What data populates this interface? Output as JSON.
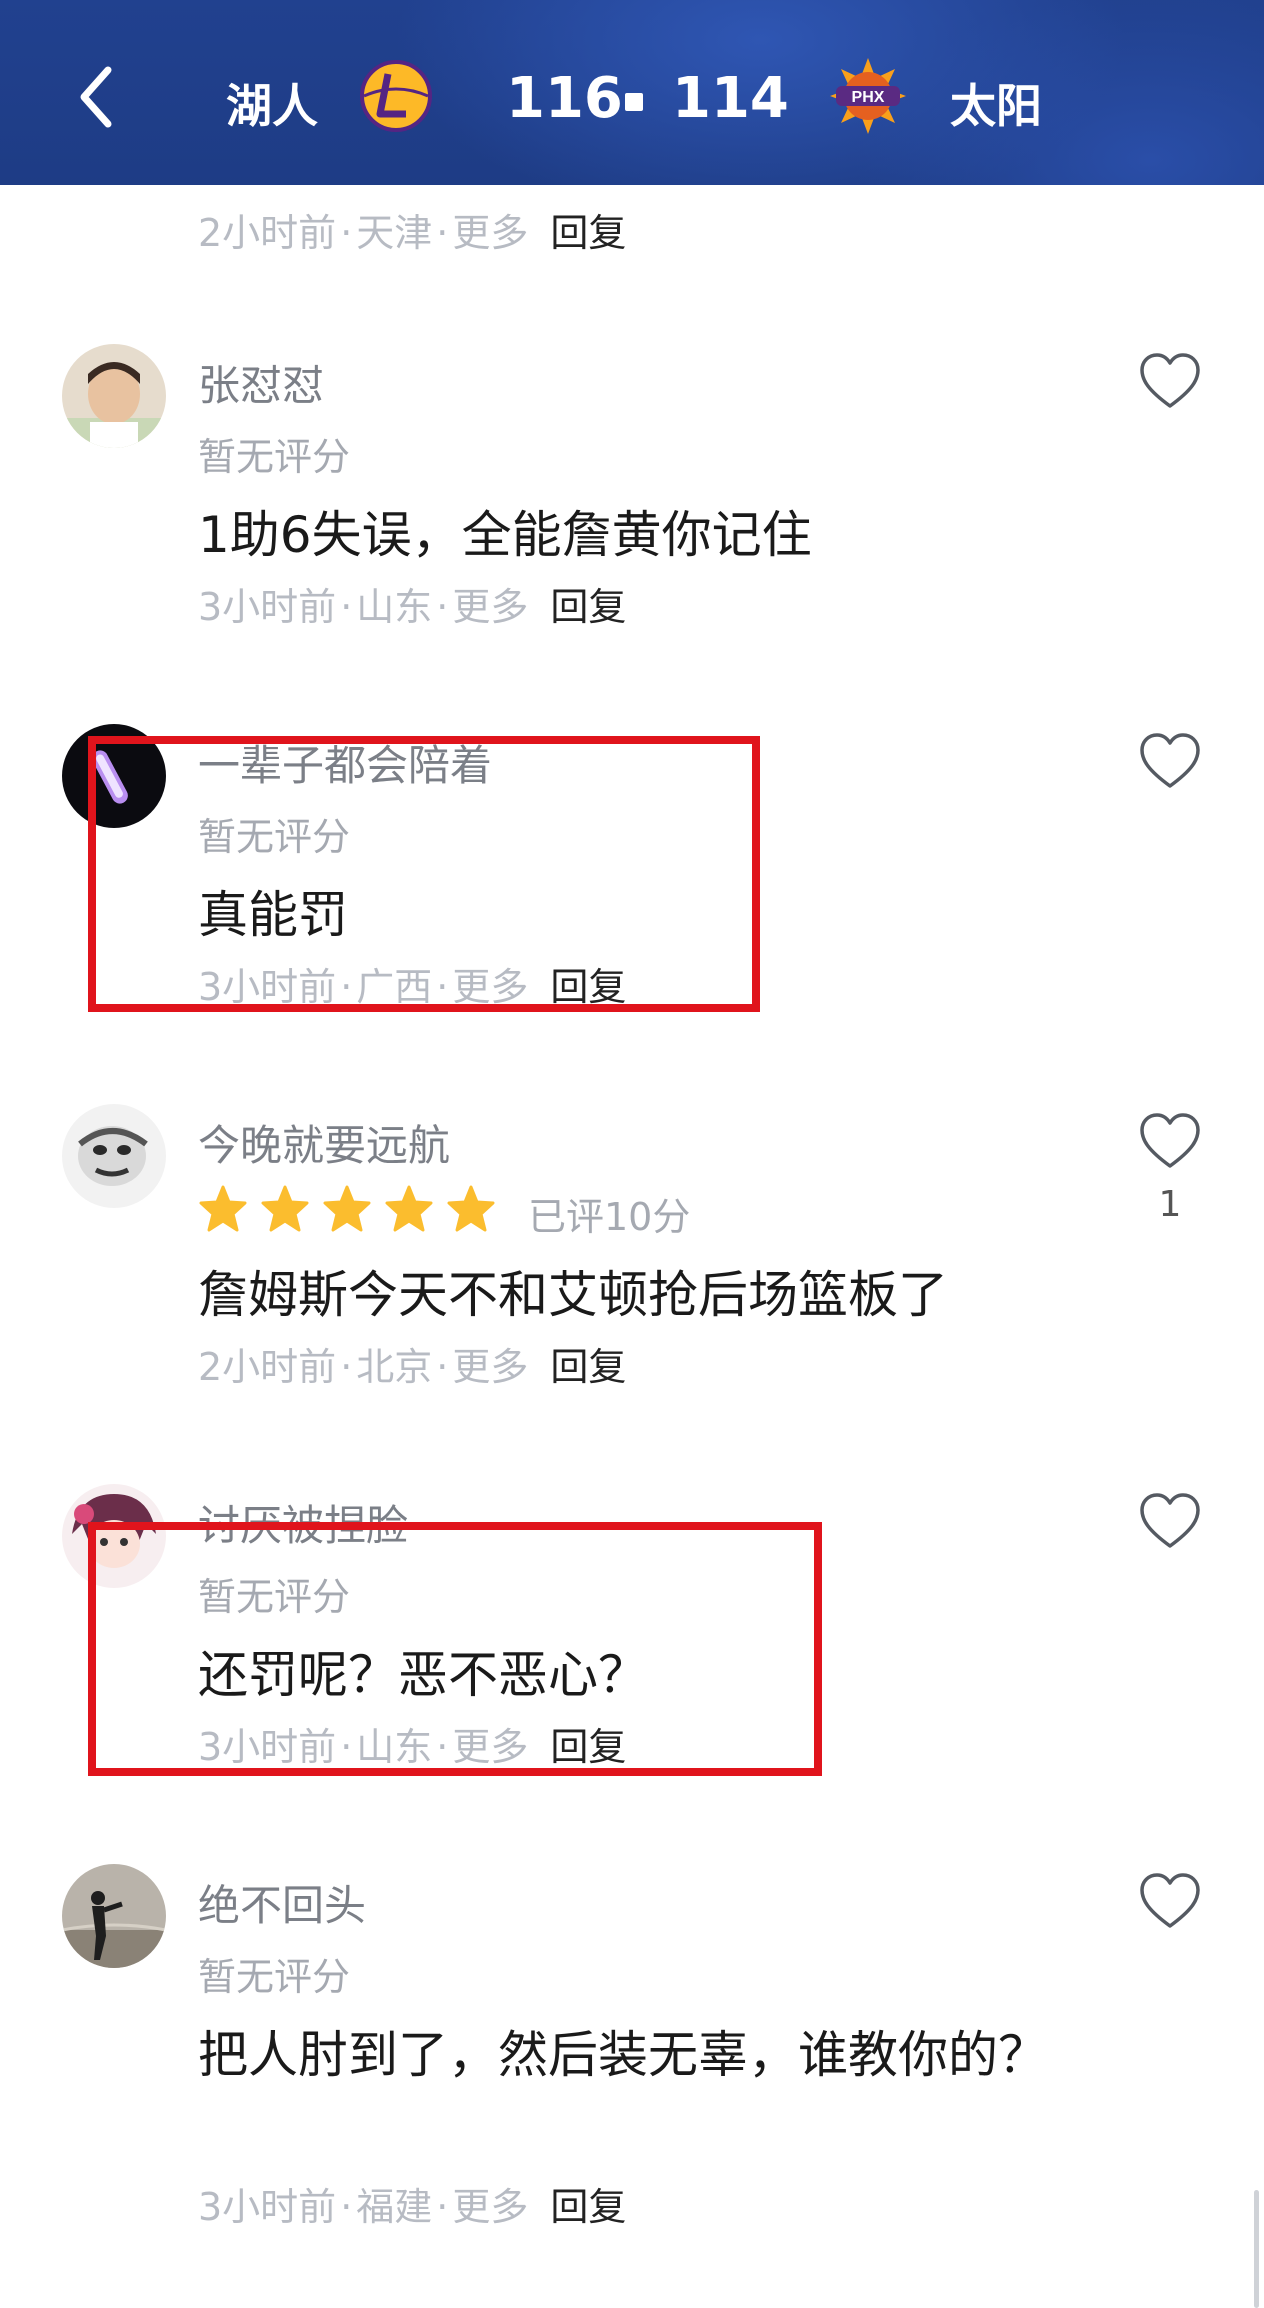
{
  "header": {
    "home_team": "湖人",
    "away_team": "太阳",
    "home_score": "116",
    "away_score": "114",
    "away_logo_text": "PHX",
    "colors": {
      "bg": "#1e3c85",
      "lakers_purple": "#552583",
      "lakers_gold": "#fdb927",
      "suns_orange": "#e56020"
    }
  },
  "top_meta": {
    "time": "2小时前",
    "location": "天津",
    "more": "更多",
    "reply": "回复"
  },
  "comments": [
    {
      "username": "张怼怼",
      "rating": "暂无评分",
      "text": "1助6失误，全能詹黄你记住",
      "time": "3小时前",
      "location": "山东",
      "more": "更多",
      "reply": "回复"
    },
    {
      "username": "一辈子都会陪着",
      "rating": "暂无评分",
      "text": "真能罚",
      "time": "3小时前",
      "location": "广西",
      "more": "更多",
      "reply": "回复"
    },
    {
      "username": "今晚就要远航",
      "stars": 5,
      "rating": "已评10分",
      "text": "詹姆斯今天不和艾顿抢后场篮板了",
      "time": "2小时前",
      "location": "北京",
      "more": "更多",
      "reply": "回复",
      "likes": "1"
    },
    {
      "username": "讨厌被捏脸",
      "rating": "暂无评分",
      "text": "还罚呢？恶不恶心？",
      "time": "3小时前",
      "location": "山东",
      "more": "更多",
      "reply": "回复"
    },
    {
      "username": "绝不回头",
      "rating": "暂无评分",
      "text": "把人肘到了，然后装无辜，谁教你的？",
      "time": "3小时前",
      "location": "福建",
      "more": "更多",
      "reply": "回复"
    }
  ],
  "star_color": "#fbbd2e",
  "highlight_color": "#e0141c"
}
